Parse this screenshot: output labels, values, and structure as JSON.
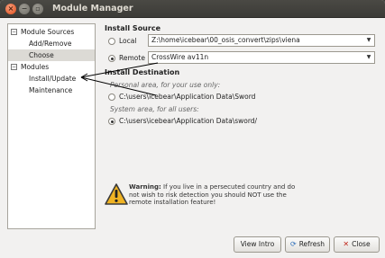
{
  "window": {
    "title": "Module Manager"
  },
  "tree": {
    "groups": [
      {
        "label": "Module Sources",
        "expander": "−",
        "items": [
          "Add/Remove",
          "Choose"
        ]
      },
      {
        "label": "Modules",
        "expander": "−",
        "items": [
          "Install/Update",
          "Maintenance"
        ]
      }
    ],
    "selected": "Choose"
  },
  "install_source": {
    "heading": "Install Source",
    "local_label": "Local",
    "local_value": "Z:\\home\\icebear\\00_osis_convert\\zips\\viena",
    "remote_label": "Remote",
    "remote_value": "CrossWire av11n",
    "selected": "remote"
  },
  "install_destination": {
    "heading": "Install Destination",
    "personal_caption": "Personal area, for your use only:",
    "personal_path": "C:\\users\\icebear\\Application Data\\Sword",
    "system_caption": "System area, for all users:",
    "system_path": "C:\\users\\icebear\\Application Data\\sword/",
    "selected": "system"
  },
  "warning": {
    "bold": "Warning:",
    "text": " If you live in a persecuted country and do not wish to risk detection you should NOT use the remote installation feature!"
  },
  "buttons": {
    "view_intro": "View Intro",
    "refresh": "Refresh",
    "close": "Close"
  },
  "colors": {
    "accent": "#df4a16",
    "warning_fill": "#f0b323"
  },
  "icons": {
    "refresh": "refresh-icon",
    "close": "close-x-icon",
    "warning": "warning-triangle-icon"
  }
}
